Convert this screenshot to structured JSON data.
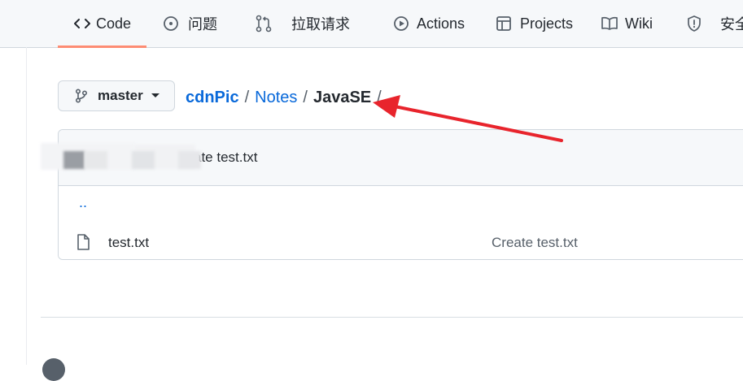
{
  "nav": {
    "tabs": [
      {
        "label": "Code",
        "icon": "code-icon"
      },
      {
        "label": "问题",
        "icon": "issue-icon"
      },
      {
        "label": "拉取请求",
        "icon": "pull-request-icon"
      },
      {
        "label": "Actions",
        "icon": "play-icon"
      },
      {
        "label": "Projects",
        "icon": "table-icon"
      },
      {
        "label": "Wiki",
        "icon": "book-icon"
      },
      {
        "label": "安全",
        "icon": "shield-icon"
      }
    ],
    "active_color": "#fd8c73"
  },
  "branch": {
    "name": "master"
  },
  "breadcrumb": {
    "repo": "cdnPic",
    "sep": "/",
    "folder": "Notes",
    "current": "JavaSE"
  },
  "commit": {
    "message_partial": "ate test.txt"
  },
  "files": {
    "parent": "..",
    "rows": [
      {
        "name": "test.txt",
        "commit": "Create test.txt",
        "icon": "file-icon"
      }
    ]
  },
  "annotation": {
    "arrow_color": "#e8242c"
  }
}
